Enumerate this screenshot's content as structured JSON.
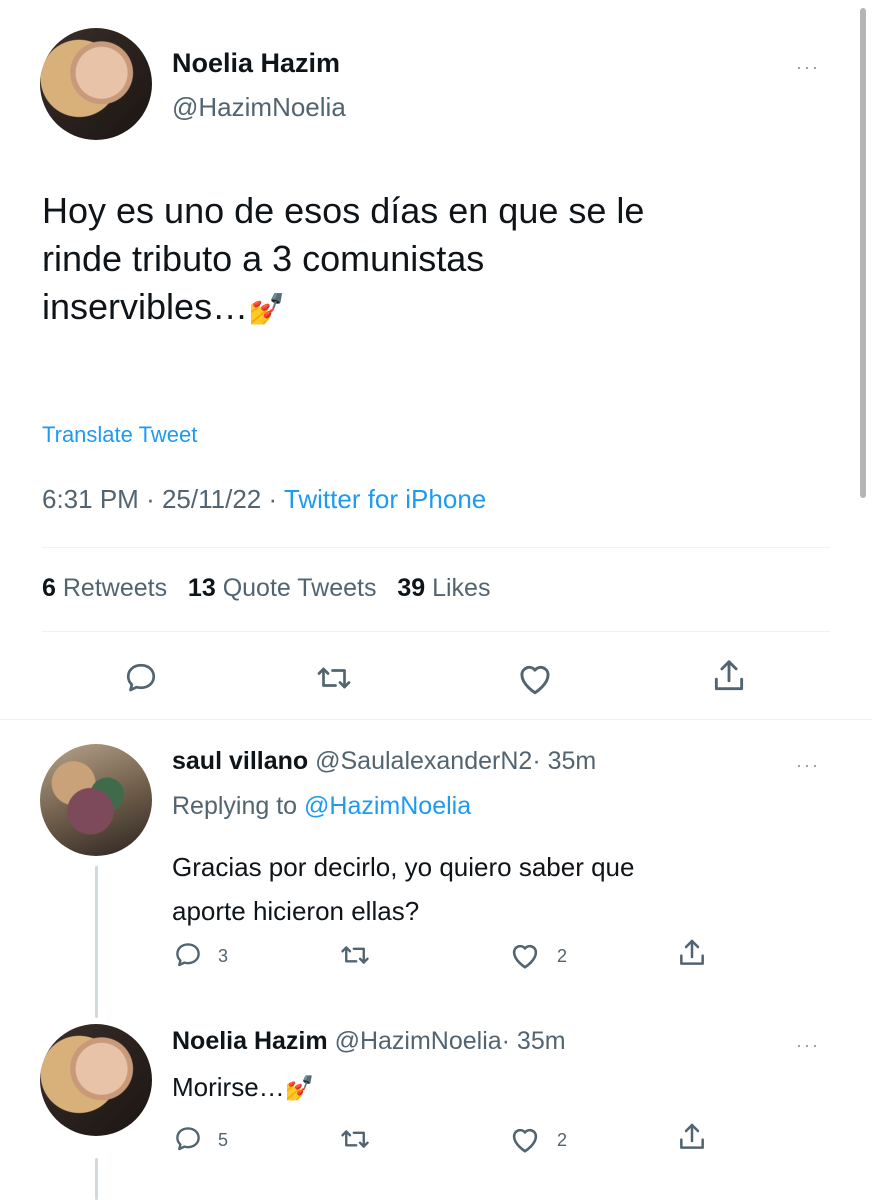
{
  "main_tweet": {
    "author_name": "Noelia Hazim",
    "author_handle": "@HazimNoelia",
    "text_line1": "Hoy es uno de esos días en que se le",
    "text_line2": "rinde tributo a 3 comunistas",
    "text_line3": "inservibles…",
    "emoji": "💅",
    "translate_label": "Translate Tweet",
    "time": "6:31 PM",
    "date": "25/11/22",
    "source": "Twitter for iPhone",
    "separator": "·",
    "stats": {
      "retweets_count": "6",
      "retweets_label": "Retweets",
      "quotes_count": "13",
      "quotes_label": "Quote Tweets",
      "likes_count": "39",
      "likes_label": "Likes"
    }
  },
  "replies": [
    {
      "author_name": "saul villano",
      "author_handle": "@SaulalexanderN2",
      "time": "· 35m",
      "replying_prefix": "Replying to",
      "replying_handle": "@HazimNoelia",
      "text_line1": "Gracias por decirlo, yo quiero saber que",
      "text_line2": "aporte hicieron ellas?",
      "reply_count": "3",
      "like_count": "2"
    },
    {
      "author_name": "Noelia Hazim",
      "author_handle": "@HazimNoelia",
      "time": "· 35m",
      "text": "Morirse…",
      "emoji": "💅",
      "reply_count": "5",
      "like_count": "2"
    }
  ],
  "icons": {
    "more": "more-icon",
    "reply": "reply-icon",
    "retweet": "retweet-icon",
    "like": "like-icon",
    "share": "share-icon"
  },
  "colors": {
    "link": "#1d9bf0",
    "muted": "#536471",
    "text": "#0f1419"
  },
  "more_glyph": "···"
}
